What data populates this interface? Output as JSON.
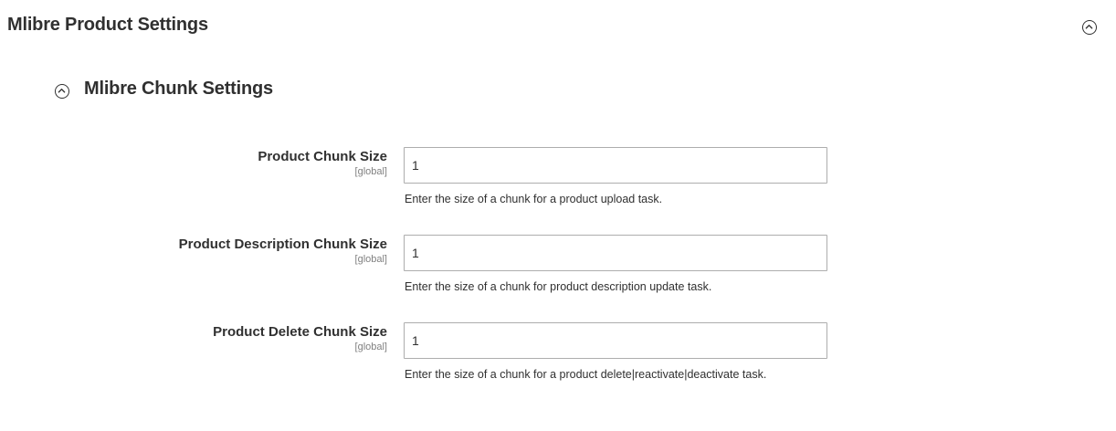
{
  "section": {
    "title": "Mlibre Product Settings",
    "toggle_icon": "chevron-up-circle-icon"
  },
  "group": {
    "title": "Mlibre Chunk Settings",
    "toggle_icon": "chevron-up-circle-icon"
  },
  "fields": [
    {
      "label": "Product Chunk Size",
      "scope": "[global]",
      "value": "1",
      "note": "Enter the size of a chunk for a product upload task."
    },
    {
      "label": "Product Description Chunk Size",
      "scope": "[global]",
      "value": "1",
      "note": "Enter the size of a chunk for product description update task."
    },
    {
      "label": "Product Delete Chunk Size",
      "scope": "[global]",
      "value": "1",
      "note": "Enter the size of a chunk for a product delete|reactivate|deactivate task."
    }
  ]
}
